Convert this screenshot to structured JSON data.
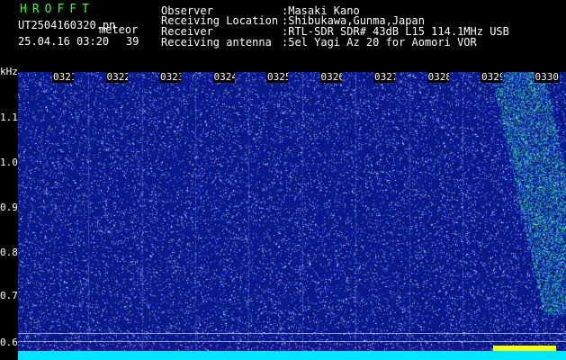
{
  "header": {
    "brand": "HROFFT",
    "filename": "UT2504160320.pn",
    "mode": "meteor",
    "datetime": "25.04.16 03:20",
    "count": "39",
    "labels": {
      "observer": "Observer",
      "location": "Receiving Location",
      "receiver": "Receiver",
      "antenna": "Receiving antenna"
    },
    "values": {
      "observer": ":Masaki Kano",
      "location": ":Shibukawa,Gunma,Japan",
      "receiver": ":RTL-SDR SDR# 43dB L15 114.1MHz USB",
      "antenna": ":5el Yagi Az 20 for Aomori VOR"
    }
  },
  "axis": {
    "unit": "kHz",
    "y_ticks": [
      "1.1",
      "1.0",
      "0.9",
      "0.8",
      "0.7",
      "0.6"
    ],
    "x_ticks": [
      "0321",
      "0322",
      "0323",
      "0324",
      "0325",
      "0326",
      "0327",
      "0328",
      "0329",
      "0330"
    ]
  },
  "colors": {
    "background": "#000000",
    "noise": "#1a2aa0",
    "signal": "#33ff66",
    "baseline": "#00e5ff",
    "header_green": "#33ff33"
  }
}
